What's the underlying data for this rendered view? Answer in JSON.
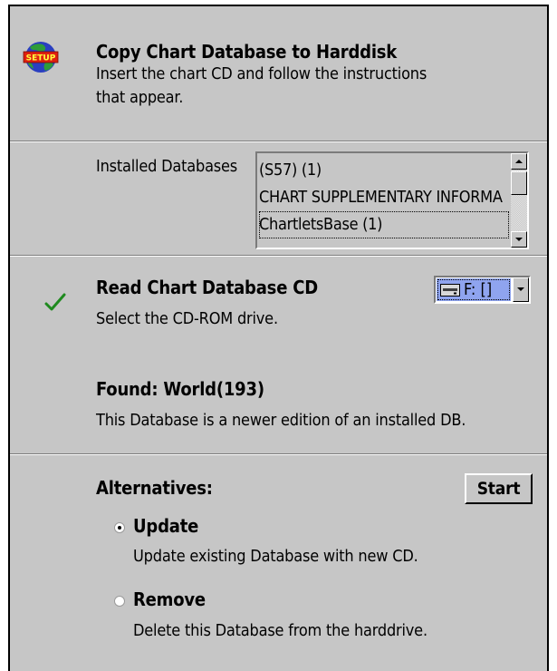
{
  "setup_icon": {
    "icon": "setup-globe-icon",
    "label": "SETUP"
  },
  "copy_section": {
    "title": "Copy Chart Database to Harddisk",
    "description_line1": "Insert the chart CD and follow the instructions",
    "description_line2": "that appear."
  },
  "installed": {
    "label": "Installed Databases",
    "items": [
      "(S57) (1)",
      "CHART SUPPLEMENTARY INFORMA",
      "ChartletsBase (1)"
    ],
    "selected_index": 2
  },
  "read_section": {
    "title": "Read Chart Database CD",
    "description": "Select the CD-ROM drive.",
    "status_icon": "checkmark-icon",
    "drive_select": {
      "icon": "drive-icon",
      "value": "F: []"
    },
    "found_title": "Found: World(193)",
    "found_description": "This Database is a newer edition of an installed DB."
  },
  "alternatives": {
    "title": "Alternatives:",
    "start_label": "Start",
    "options": [
      {
        "label": "Update",
        "description": "Update existing Database with new CD.",
        "checked": true
      },
      {
        "label": "Remove",
        "description": "Delete this Database from the harddrive.",
        "checked": false
      }
    ]
  },
  "colors": {
    "panel": "#c6c6c6",
    "selection": "#8fa4ef",
    "checkmark": "#1f8a1f"
  }
}
